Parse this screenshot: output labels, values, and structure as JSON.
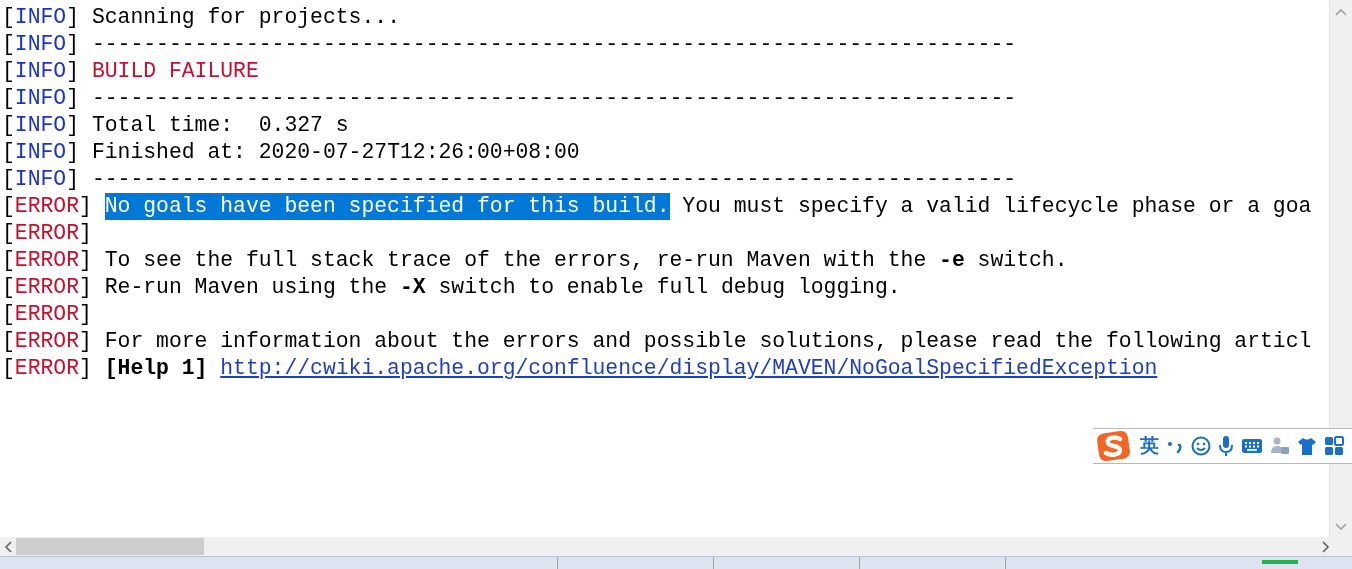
{
  "console": {
    "lines": [
      {
        "kind": "info",
        "tag": "[INFO]",
        "segments": [
          {
            "kind": "text",
            "text": "Scanning for projects..."
          }
        ]
      },
      {
        "kind": "info",
        "tag": "[INFO]",
        "segments": [
          {
            "kind": "text",
            "text": "------------------------------------------------------------------------"
          }
        ]
      },
      {
        "kind": "info",
        "tag": "[INFO]",
        "segments": [
          {
            "kind": "failure",
            "text": "BUILD FAILURE"
          }
        ]
      },
      {
        "kind": "info",
        "tag": "[INFO]",
        "segments": [
          {
            "kind": "text",
            "text": "------------------------------------------------------------------------"
          }
        ]
      },
      {
        "kind": "info",
        "tag": "[INFO]",
        "segments": [
          {
            "kind": "text",
            "text": "Total time:  0.327 s"
          }
        ]
      },
      {
        "kind": "info",
        "tag": "[INFO]",
        "segments": [
          {
            "kind": "text",
            "text": "Finished at: 2020-07-27T12:26:00+08:00"
          }
        ]
      },
      {
        "kind": "info",
        "tag": "[INFO]",
        "segments": [
          {
            "kind": "text",
            "text": "------------------------------------------------------------------------"
          }
        ]
      },
      {
        "kind": "error",
        "tag": "[ERROR]",
        "segments": [
          {
            "kind": "selection",
            "text": "No goals have been specified for this build."
          },
          {
            "kind": "text",
            "text": " You must specify a valid lifecycle phase or a goa"
          }
        ]
      },
      {
        "kind": "error",
        "tag": "[ERROR]"
      },
      {
        "kind": "error",
        "tag": "[ERROR]",
        "segments": [
          {
            "kind": "text",
            "text": "To see the full stack trace of the errors, re-run Maven with the "
          },
          {
            "kind": "bold",
            "text": "-e"
          },
          {
            "kind": "text",
            "text": " switch."
          }
        ]
      },
      {
        "kind": "error",
        "tag": "[ERROR]",
        "segments": [
          {
            "kind": "text",
            "text": "Re-run Maven using the "
          },
          {
            "kind": "bold",
            "text": "-X"
          },
          {
            "kind": "text",
            "text": " switch to enable full debug logging."
          }
        ]
      },
      {
        "kind": "error",
        "tag": "[ERROR]"
      },
      {
        "kind": "error",
        "tag": "[ERROR]",
        "segments": [
          {
            "kind": "text",
            "text": "For more information about the errors and possible solutions, please read the following articl"
          }
        ]
      },
      {
        "kind": "error",
        "tag": "[ERROR]",
        "segments": [
          {
            "kind": "bold",
            "text": "[Help 1]"
          },
          {
            "kind": "link",
            "text": "http://cwiki.apache.org/confluence/display/MAVEN/NoGoalSpecifiedException"
          }
        ]
      }
    ]
  },
  "ime_toolbar": {
    "language": "英"
  }
}
